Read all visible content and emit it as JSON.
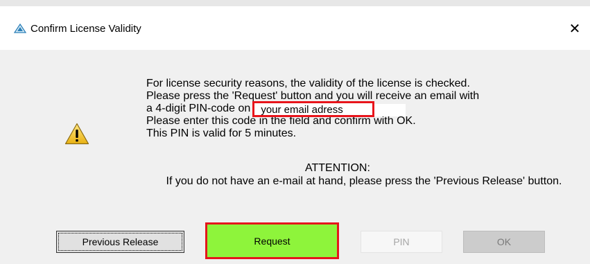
{
  "window": {
    "title": "Confirm License Validity",
    "close_glyph": "✕",
    "icons": {
      "app": "delta-triangle-icon",
      "warning": "warning-icon"
    }
  },
  "message": {
    "line1": "For license security reasons, the validity of the license is checked.",
    "line2": "Please press the 'Request' button and you will receive an email with",
    "line3_prefix": "a 4-digit PIN-code on",
    "email": "your email adress",
    "line4": "Please enter this code in the field and confirm with OK.",
    "line5": "This PIN is valid for 5 minutes."
  },
  "attention": {
    "heading": "ATTENTION:",
    "text": "If you do not have an e-mail at hand, please press the 'Previous Release' button."
  },
  "buttons": {
    "previous_release": "Previous Release",
    "request": "Request",
    "pin": "PIN",
    "ok": "OK"
  },
  "colors": {
    "request_bg": "#8ef43b",
    "highlight_border": "#e4161c"
  }
}
